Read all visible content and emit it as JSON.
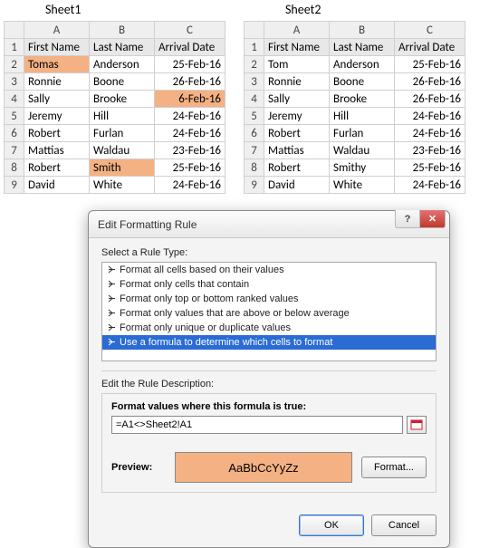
{
  "sheets": [
    {
      "title": "Sheet1",
      "cols": [
        "A",
        "B",
        "C"
      ],
      "header": [
        "First Name",
        "Last Name",
        "Arrival Date"
      ],
      "rows": [
        {
          "n": "2",
          "a": "Tomas",
          "b": "Anderson",
          "c": "25-Feb-16",
          "hl": [
            "a"
          ]
        },
        {
          "n": "3",
          "a": "Ronnie",
          "b": "Boone",
          "c": "26-Feb-16",
          "hl": []
        },
        {
          "n": "4",
          "a": "Sally",
          "b": "Brooke",
          "c": "6-Feb-16",
          "hl": [
            "c"
          ]
        },
        {
          "n": "5",
          "a": "Jeremy",
          "b": "Hill",
          "c": "24-Feb-16",
          "hl": []
        },
        {
          "n": "6",
          "a": "Robert",
          "b": "Furlan",
          "c": "24-Feb-16",
          "hl": []
        },
        {
          "n": "7",
          "a": "Mattias",
          "b": "Waldau",
          "c": "23-Feb-16",
          "hl": []
        },
        {
          "n": "8",
          "a": "Robert",
          "b": "Smith",
          "c": "25-Feb-16",
          "hl": [
            "b"
          ]
        },
        {
          "n": "9",
          "a": "David",
          "b": "White",
          "c": "24-Feb-16",
          "hl": []
        }
      ]
    },
    {
      "title": "Sheet2",
      "cols": [
        "A",
        "B",
        "C"
      ],
      "header": [
        "First Name",
        "Last Name",
        "Arrival Date"
      ],
      "rows": [
        {
          "n": "2",
          "a": "Tom",
          "b": "Anderson",
          "c": "25-Feb-16",
          "hl": []
        },
        {
          "n": "3",
          "a": "Ronnie",
          "b": "Boone",
          "c": "26-Feb-16",
          "hl": []
        },
        {
          "n": "4",
          "a": "Sally",
          "b": "Brooke",
          "c": "26-Feb-16",
          "hl": []
        },
        {
          "n": "5",
          "a": "Jeremy",
          "b": "Hill",
          "c": "24-Feb-16",
          "hl": []
        },
        {
          "n": "6",
          "a": "Robert",
          "b": "Furlan",
          "c": "24-Feb-16",
          "hl": []
        },
        {
          "n": "7",
          "a": "Mattias",
          "b": "Waldau",
          "c": "23-Feb-16",
          "hl": []
        },
        {
          "n": "8",
          "a": "Robert",
          "b": "Smithy",
          "c": "25-Feb-16",
          "hl": []
        },
        {
          "n": "9",
          "a": "David",
          "b": "White",
          "c": "24-Feb-16",
          "hl": []
        }
      ]
    }
  ],
  "dialog": {
    "title": "Edit Formatting Rule",
    "help_glyph": "?",
    "close_glyph": "✕",
    "select_rule_label": "Select a Rule Type:",
    "rule_types": [
      "Format all cells based on their values",
      "Format only cells that contain",
      "Format only top or bottom ranked values",
      "Format only values that are above or below average",
      "Format only unique or duplicate values",
      "Use a formula to determine which cells to format"
    ],
    "rule_type_selected_index": 5,
    "edit_desc_label": "Edit the Rule Description:",
    "formula_label": "Format values where this formula is true:",
    "formula_value": "=A1<>Sheet2!A1",
    "preview_label": "Preview:",
    "preview_text": "AaBbCcYyZz",
    "format_button": "Format...",
    "ok_button": "OK",
    "cancel_button": "Cancel"
  }
}
